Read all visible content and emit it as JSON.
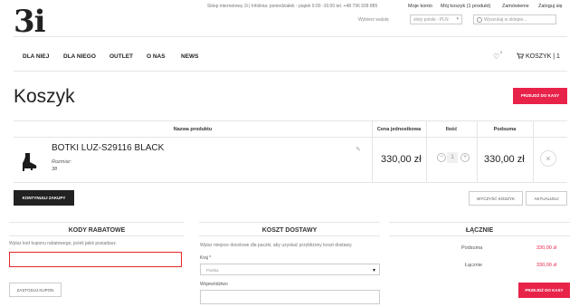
{
  "header": {
    "logo": "3i",
    "info": "Sklep internetowy 3i | Infolinia: poniedziałek - piątek 9:00 -16:00 tel. +48 796 938 885",
    "links": [
      "Moje konto",
      "Mój koszyk (1 produkt)",
      "Zamówienie",
      "Zaloguj się"
    ],
    "currency_label": "Wybierz walutę",
    "currency_value": "złoty polski - PLN",
    "search_placeholder": "Wyszukaj w sklepie..."
  },
  "nav": {
    "items": [
      "DLA NIEJ",
      "DLA NIEGO",
      "OUTLET",
      "O NAS",
      "NEWS"
    ],
    "wishlist_count": "0",
    "cart_label": "KOSZYK | 1"
  },
  "page": {
    "title": "Koszyk",
    "checkout_button": "PRZEJDŹ DO KASY"
  },
  "table": {
    "headers": [
      "Nazwa produktu",
      "Cena jednostkowa",
      "Ilość",
      "Podsuma"
    ],
    "row": {
      "name": "BOTKI LUZ-S29116 BLACK",
      "attr_label": "Rozmiar:",
      "attr_value": "38",
      "unit_price": "330,00 zł",
      "qty": "1",
      "subtotal": "330,00 zł"
    }
  },
  "actions": {
    "continue": "KONTYNUUJ ZAKUPY",
    "clear": "WYCZYŚĆ KOSZYK",
    "update": "AKTUALIZUJ"
  },
  "discount": {
    "title": "KODY RABATOWE",
    "hint": "Wpisz kod kuponu rabatowego, jeżeli jakiś posiadasz.",
    "apply": "ZASTOSUJ KUPON"
  },
  "shipping": {
    "title": "KOSZT DOSTAWY",
    "hint": "Wpisz miejsce docelowe dla paczki, aby uzyskać przybliżony koszt dostawy.",
    "country_label": "Kraj *",
    "country_value": "Polska",
    "region_label": "Województwo"
  },
  "totals": {
    "title": "ŁĄCZNIE",
    "subtotal_label": "Podsuma",
    "subtotal_value": "330,00 zł",
    "total_label": "Łącznie",
    "total_value": "330,00 zł",
    "checkout_button": "PRZEJDŹ DO KASY"
  },
  "colors": {
    "accent": "#e8234a",
    "dark": "#222222",
    "highlight": "#e52626"
  }
}
